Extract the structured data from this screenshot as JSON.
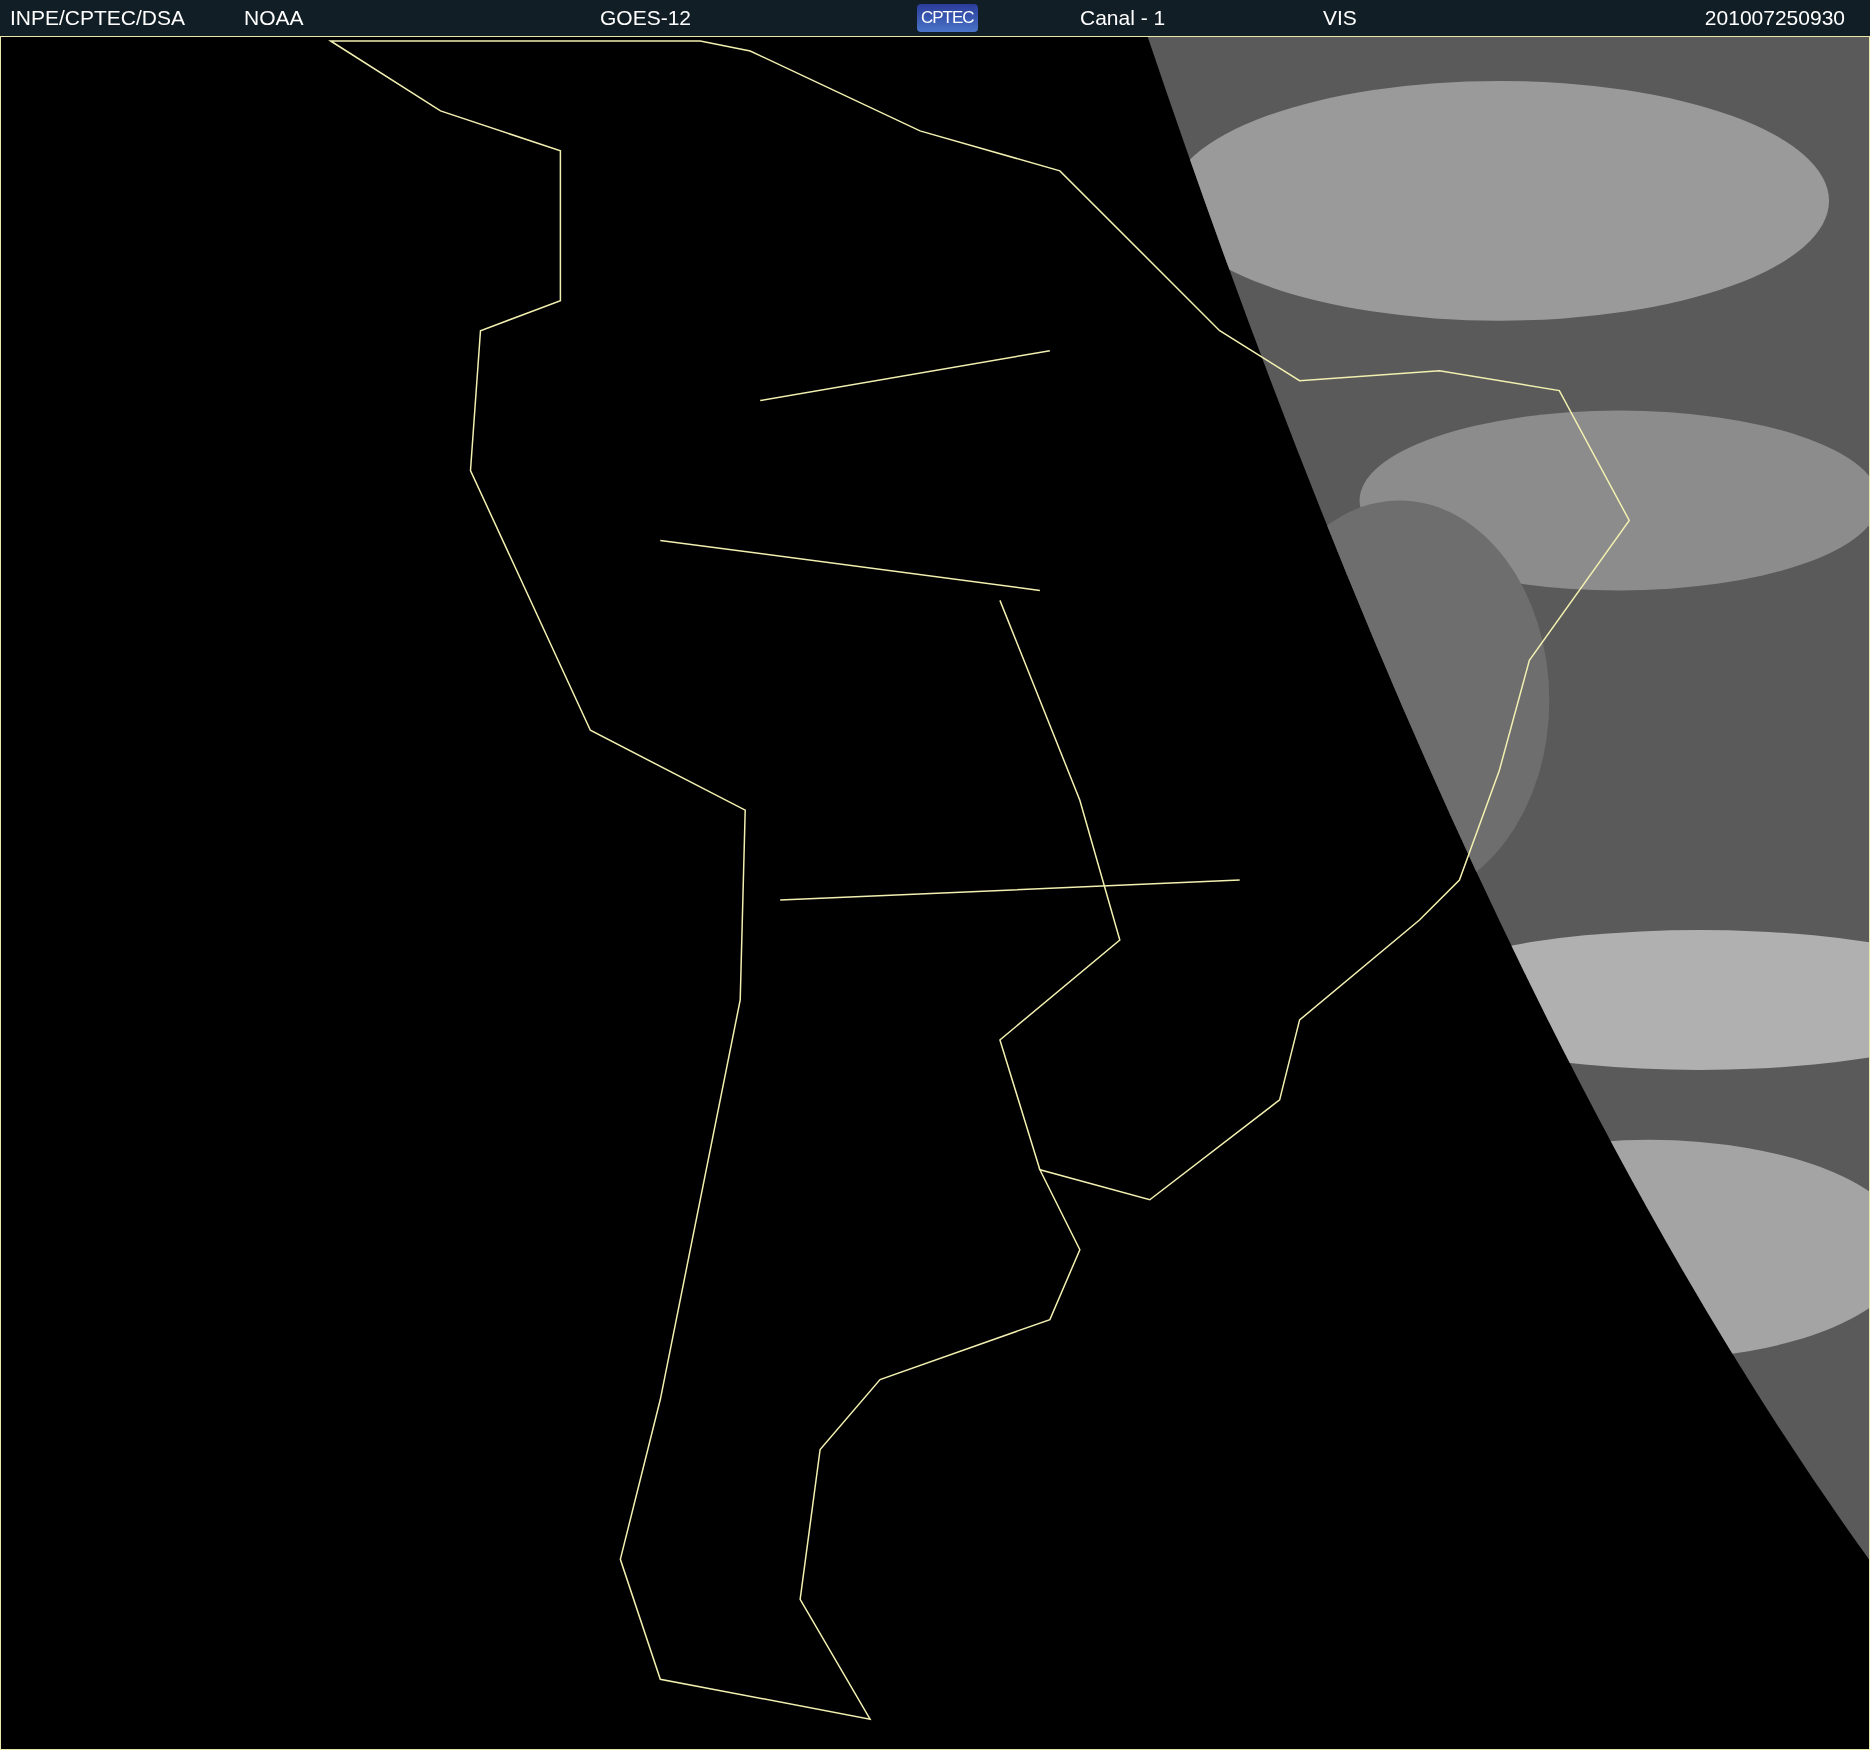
{
  "header": {
    "items": [
      {
        "kind": "text",
        "text": "INPE/CPTEC/DSA"
      },
      {
        "kind": "text",
        "text": "NOAA"
      },
      {
        "kind": "text",
        "text": "GOES-12"
      },
      {
        "kind": "logo",
        "text": "CPTEC"
      },
      {
        "kind": "text",
        "text": "Canal - 1"
      },
      {
        "kind": "text",
        "text": "VIS"
      },
      {
        "kind": "text",
        "text": "201007250930"
      }
    ]
  }
}
